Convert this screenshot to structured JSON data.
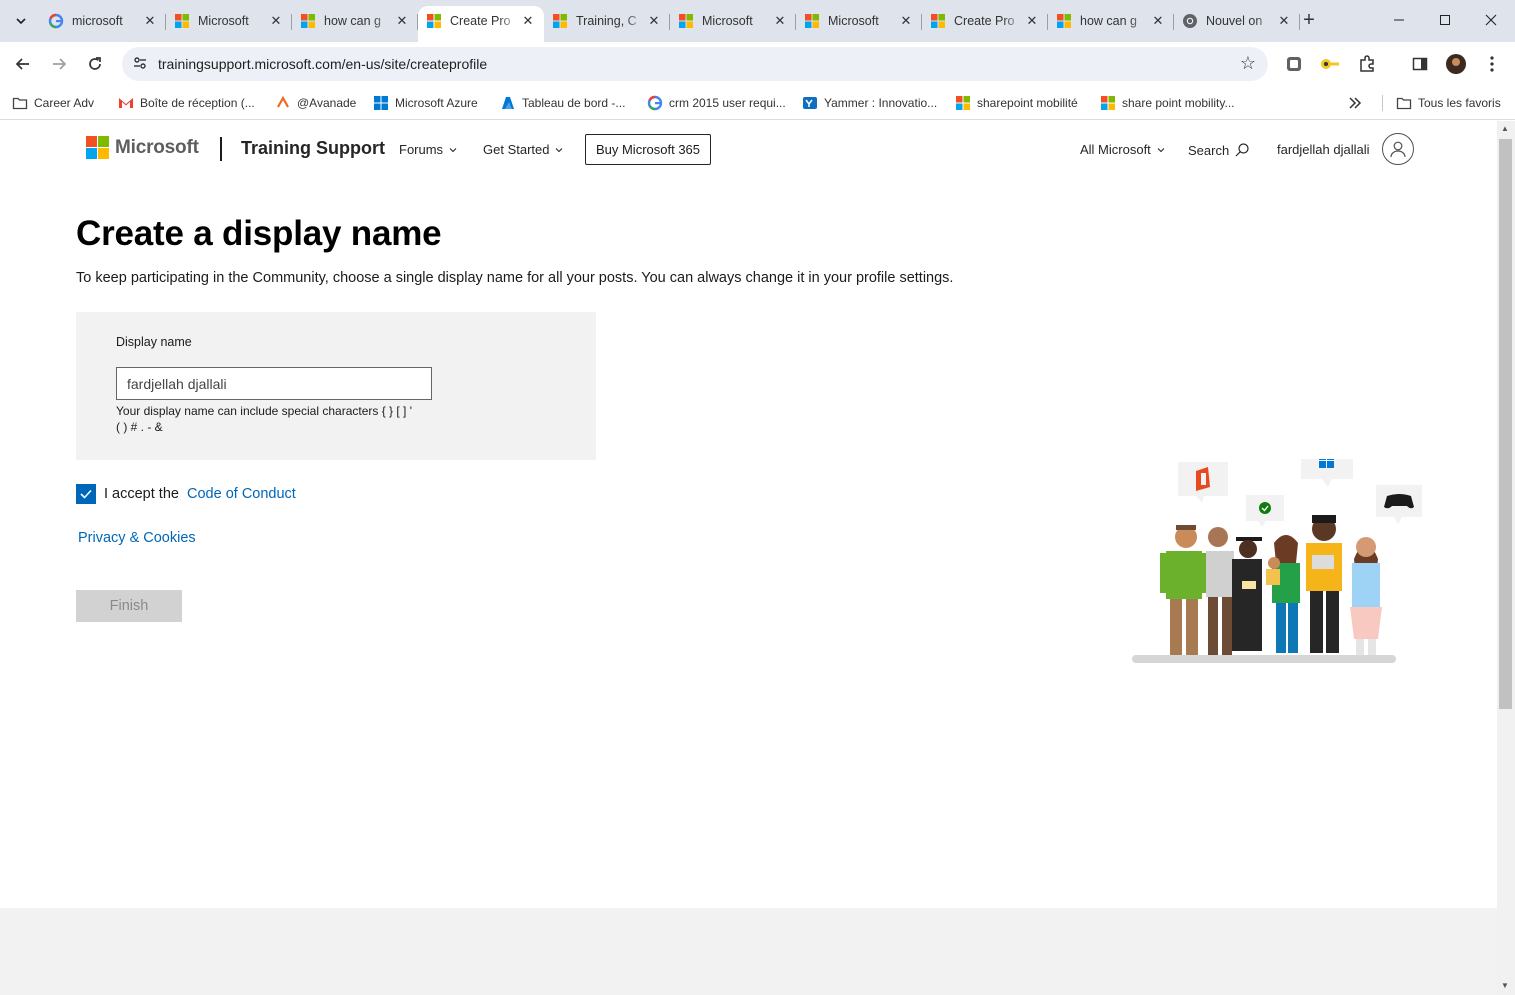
{
  "browser": {
    "tabs": [
      {
        "title": "microsoft",
        "favicon": "google-icon",
        "active": false
      },
      {
        "title": "Microsoft",
        "favicon": "microsoft-icon",
        "active": false
      },
      {
        "title": "how can g",
        "favicon": "microsoft-icon",
        "active": false
      },
      {
        "title": "Create Pro",
        "favicon": "microsoft-icon",
        "active": true
      },
      {
        "title": "Training, C",
        "favicon": "microsoft-icon",
        "active": false
      },
      {
        "title": "Microsoft",
        "favicon": "microsoft-icon",
        "active": false
      },
      {
        "title": "Microsoft",
        "favicon": "microsoft-icon",
        "active": false
      },
      {
        "title": "Create Pro",
        "favicon": "microsoft-icon",
        "active": false
      },
      {
        "title": "how can g",
        "favicon": "microsoft-icon",
        "active": false
      },
      {
        "title": "Nouvel on",
        "favicon": "chrome-icon",
        "active": false
      }
    ],
    "url": "trainingsupport.microsoft.com/en-us/site/createprofile",
    "bookmarks": [
      {
        "label": "Career Adv",
        "icon": "folder-icon"
      },
      {
        "label": "Boîte de réception (...",
        "icon": "gmail-icon"
      },
      {
        "label": "@Avanade",
        "icon": "avanade-icon"
      },
      {
        "label": "Microsoft Azure",
        "icon": "windows-icon"
      },
      {
        "label": "Tableau de bord -...",
        "icon": "azure-icon"
      },
      {
        "label": "crm 2015 user requi...",
        "icon": "google-icon"
      },
      {
        "label": "Yammer : Innovatio...",
        "icon": "yammer-icon"
      },
      {
        "label": "sharepoint mobilité",
        "icon": "microsoft-icon"
      },
      {
        "label": "share point mobility...",
        "icon": "microsoft-icon"
      }
    ],
    "all_bookmarks": "Tous les favoris"
  },
  "header": {
    "brand": "Microsoft",
    "site_title": "Training Support",
    "nav": [
      "Forums",
      "Get Started"
    ],
    "buy_button": "Buy Microsoft 365",
    "all_microsoft": "All Microsoft",
    "search": "Search",
    "user_name": "fardjellah djallali"
  },
  "main": {
    "title": "Create a display name",
    "intro": "To keep participating in the Community, choose a single display name for all your posts. You can always change it in your profile settings.",
    "field_label": "Display name",
    "field_value": "fardjellah djallali",
    "hint_line1": "Your display name can include special characters { } [ ] '",
    "hint_line2": "( ) # . - &",
    "accept_prefix": "I accept the",
    "code_of_conduct": "Code of Conduct",
    "accept_checked": true,
    "privacy": "Privacy & Cookies",
    "finish": "Finish"
  },
  "colors": {
    "tabstrip": "#dfe3eb",
    "link": "#0067b8",
    "ms_red": "#f25022",
    "ms_green": "#7fba00",
    "ms_blue": "#00a4ef",
    "ms_yellow": "#ffb900"
  }
}
